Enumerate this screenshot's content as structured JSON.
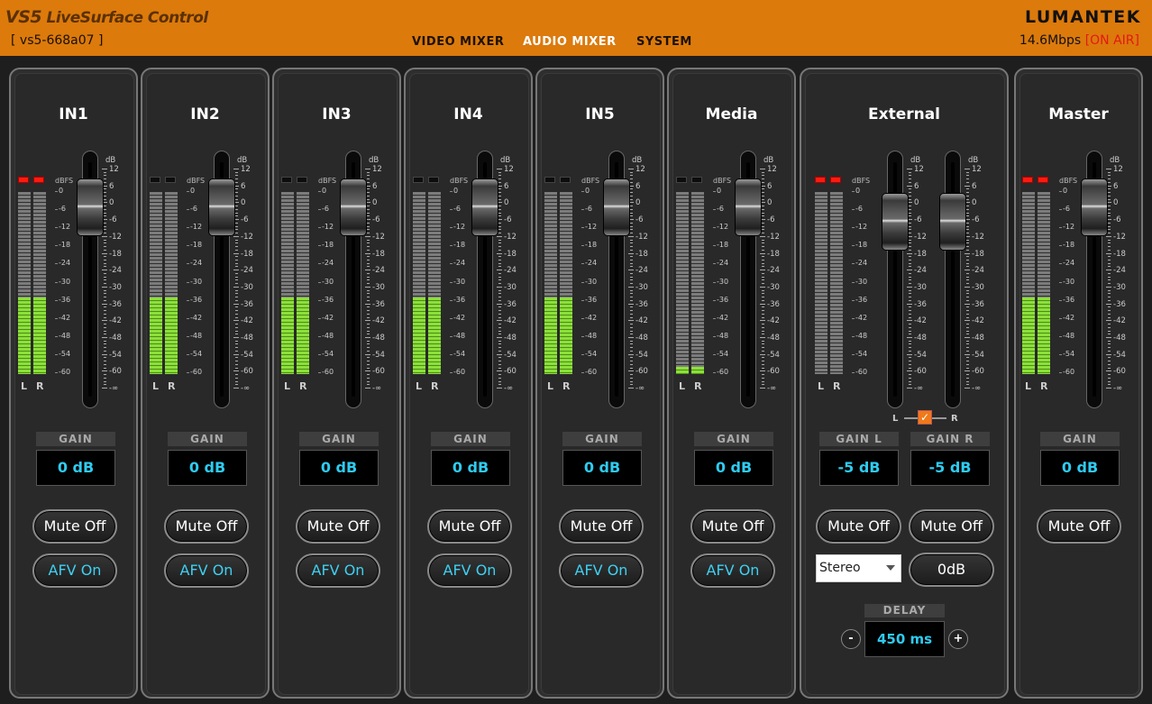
{
  "header": {
    "title_prefix": "VS5",
    "title_suffix": " LiveSurface Control",
    "device_id": "[ vs5-668a07 ]",
    "brand": "LUMANTEK",
    "bitrate": "14.6Mbps",
    "onair": "[ON AIR]",
    "nav": [
      {
        "label": "VIDEO MIXER",
        "active": false
      },
      {
        "label": "AUDIO MIXER",
        "active": true
      },
      {
        "label": "SYSTEM",
        "active": false
      }
    ]
  },
  "meter_labels": {
    "left": "L",
    "right": "R",
    "dbfs_header": "dBFS",
    "db_header": "dB"
  },
  "dbfs_scale": [
    "0",
    "-6",
    "-12",
    "-18",
    "-24",
    "-30",
    "-36",
    "-42",
    "-48",
    "-54",
    "-60"
  ],
  "fader_scale": [
    "12",
    "6",
    "0",
    "-6",
    "-12",
    "-18",
    "-24",
    "-30",
    "-36",
    "-42",
    "-48",
    "-54",
    "-60",
    "-∞"
  ],
  "gain_label": "GAIN",
  "channels": [
    {
      "name": "IN1",
      "clip_lit": true,
      "level_l": 0.42,
      "level_r": 0.42,
      "gain": "0 dB",
      "mute": "Mute Off",
      "afv": "AFV On"
    },
    {
      "name": "IN2",
      "clip_lit": false,
      "level_l": 0.42,
      "level_r": 0.42,
      "gain": "0 dB",
      "mute": "Mute Off",
      "afv": "AFV On"
    },
    {
      "name": "IN3",
      "clip_lit": false,
      "level_l": 0.42,
      "level_r": 0.42,
      "gain": "0 dB",
      "mute": "Mute Off",
      "afv": "AFV On"
    },
    {
      "name": "IN4",
      "clip_lit": false,
      "level_l": 0.42,
      "level_r": 0.42,
      "gain": "0 dB",
      "mute": "Mute Off",
      "afv": "AFV On"
    },
    {
      "name": "IN5",
      "clip_lit": false,
      "level_l": 0.42,
      "level_r": 0.42,
      "gain": "0 dB",
      "mute": "Mute Off",
      "afv": "AFV On"
    },
    {
      "name": "Media",
      "clip_lit": false,
      "level_l": 0.04,
      "level_r": 0.04,
      "gain": "0 dB",
      "mute": "Mute Off",
      "afv": "AFV On"
    }
  ],
  "external": {
    "name": "External",
    "clip_lit": true,
    "level_l": 0.0,
    "level_r": 0.0,
    "gain_l_label": "GAIN  L",
    "gain_r_label": "GAIN  R",
    "gain_l": "-5 dB",
    "gain_r": "-5 dB",
    "mute_l": "Mute Off",
    "mute_r": "Mute Off",
    "mode": "Stereo",
    "trim": "0dB",
    "link_l": "L",
    "link_r": "R",
    "link_checked": true,
    "delay_label": "DELAY",
    "delay": "450 ms",
    "minus": "-",
    "plus": "+"
  },
  "master": {
    "name": "Master",
    "clip_lit": true,
    "level_l": 0.42,
    "level_r": 0.42,
    "gain": "0 dB",
    "mute": "Mute Off"
  },
  "colors": {
    "header_bg": "#dc7a0c",
    "accent_cyan": "#2fcbf0",
    "onair_red": "#e21a12",
    "meter_green": "#8ce03a",
    "clip_red": "#ff1a0e"
  }
}
